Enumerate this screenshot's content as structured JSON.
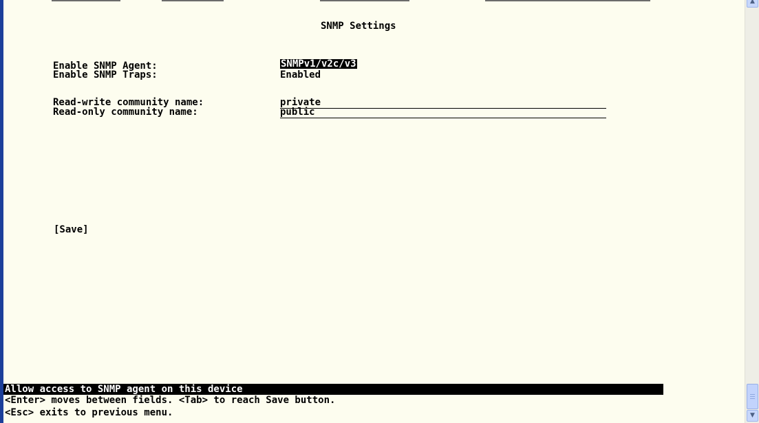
{
  "screen": {
    "title": "SNMP Settings"
  },
  "fields": {
    "snmp_agent": {
      "label": "Enable SNMP Agent:",
      "value": "SNMPv1/v2c/v3"
    },
    "snmp_traps": {
      "label": "Enable SNMP Traps:",
      "value": "Enabled"
    },
    "rw_community": {
      "label": "Read-write community name:",
      "value": "private"
    },
    "ro_community": {
      "label": "Read-only community name:",
      "value": "public"
    }
  },
  "actions": {
    "save_label": "[Save]"
  },
  "status_bar": {
    "text": "Allow access to SNMP agent on this device"
  },
  "help": {
    "line1": "<Enter> moves between fields. <Tab> to reach Save button.",
    "line2": "<Esc> exits to previous menu."
  },
  "colors": {
    "terminal_background": "#fdfdef",
    "text": "#000000",
    "highlight_background": "#000000",
    "highlight_text": "#ffffff",
    "window_border": "#1c3f9a"
  },
  "icons": {
    "scroll_up": "chevron-up-icon",
    "scroll_down": "chevron-down-icon"
  }
}
